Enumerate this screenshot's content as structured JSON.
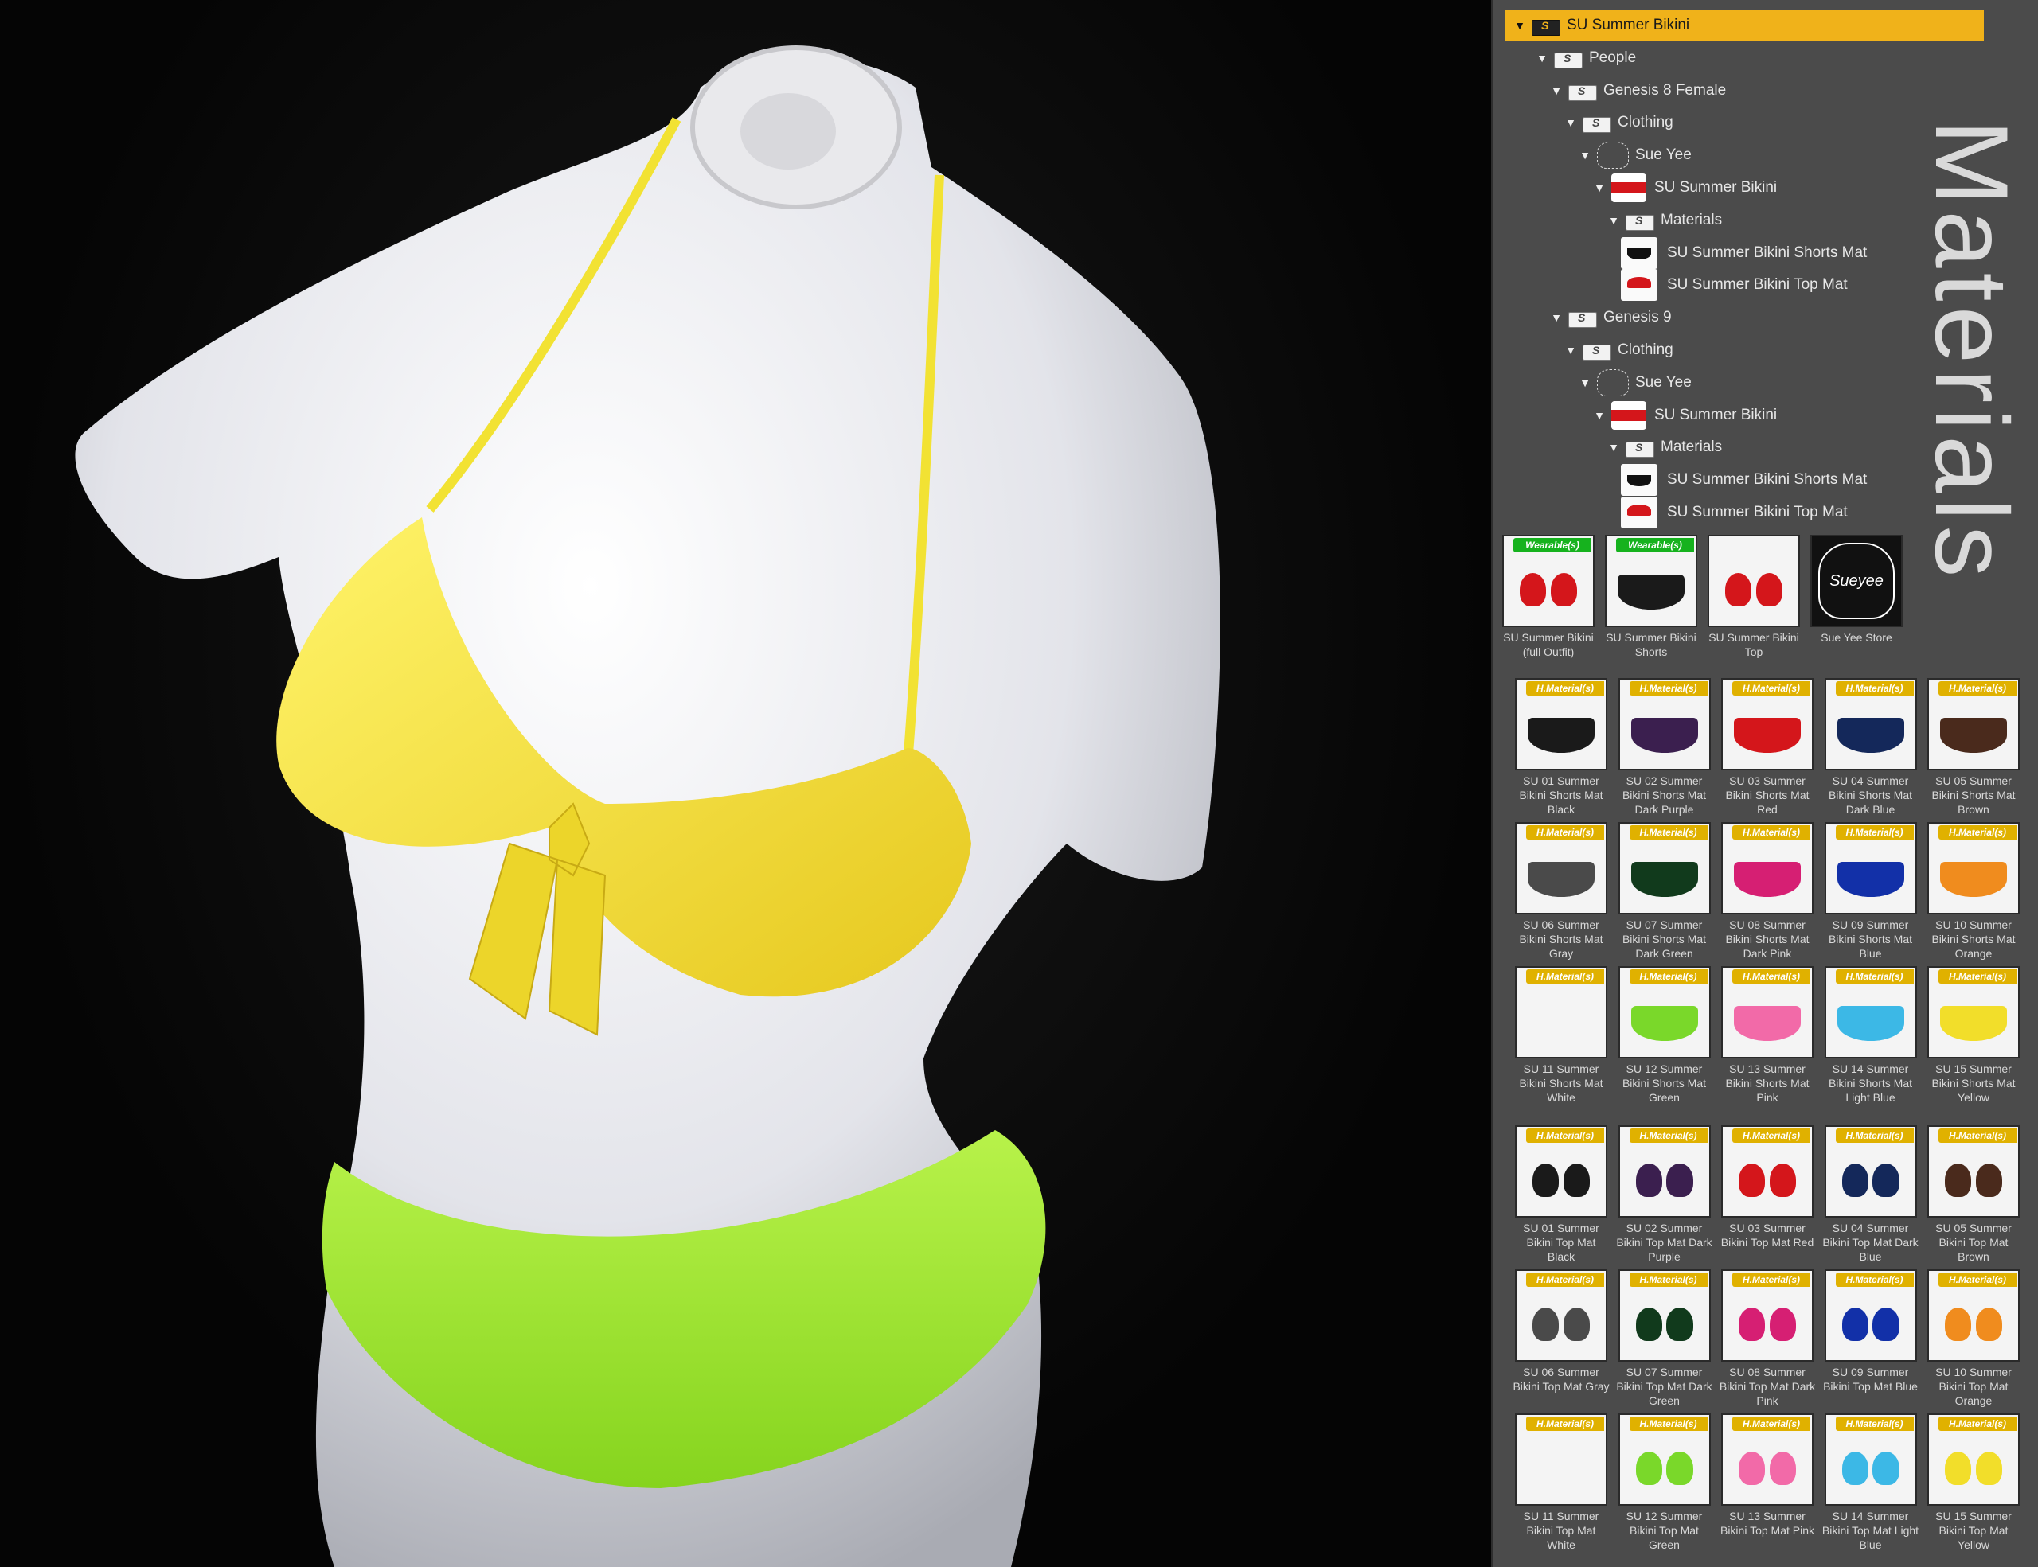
{
  "tree": [
    {
      "label": "SU Summer Bikini",
      "icon": "folder-icon",
      "selected": true
    },
    {
      "label": "People",
      "icon": "folder-icon"
    },
    {
      "label": "Genesis 8 Female",
      "icon": "folder-icon"
    },
    {
      "label": "Clothing",
      "icon": "folder-icon"
    },
    {
      "label": "Sue Yee",
      "icon": "vendor-icon"
    },
    {
      "label": "SU Summer Bikini",
      "icon": "product-icon"
    },
    {
      "label": "Materials",
      "icon": "folder-icon"
    },
    {
      "label": "SU Summer Bikini Shorts Mat",
      "icon": "material-icon"
    },
    {
      "label": "SU Summer Bikini Top Mat",
      "icon": "material-icon"
    },
    {
      "label": "Genesis 9",
      "icon": "folder-icon"
    },
    {
      "label": "Clothing",
      "icon": "folder-icon"
    },
    {
      "label": "Sue Yee",
      "icon": "vendor-icon"
    },
    {
      "label": "SU Summer Bikini",
      "icon": "product-icon"
    },
    {
      "label": "Materials",
      "icon": "folder-icon"
    },
    {
      "label": "SU Summer Bikini Shorts Mat",
      "icon": "material-icon"
    },
    {
      "label": "SU Summer Bikini Top Mat",
      "icon": "material-icon"
    }
  ],
  "side_title": "Materials",
  "top_tiles": [
    {
      "badge": "Wearable(s)",
      "caption": "SU Summer Bikini\n(full Outfit)"
    },
    {
      "badge": "Wearable(s)",
      "caption": "SU Summer Bikini\nShorts"
    },
    {
      "badge": "",
      "caption": "SU Summer Bikini\nTop"
    },
    {
      "badge": "",
      "caption": "Sue Yee Store",
      "logo": "Sueyee"
    }
  ],
  "mat_badge": "H.Material(s)",
  "shorts_tiles": [
    {
      "caption": "SU 01 Summer\nBikini Shorts Mat\nBlack",
      "color": "#1a1a1a"
    },
    {
      "caption": "SU 02 Summer\nBikini Shorts Mat\nDark Purple",
      "color": "#3b1f4f"
    },
    {
      "caption": "SU 03 Summer\nBikini Shorts Mat\nRed",
      "color": "#d4161b"
    },
    {
      "caption": "SU 04 Summer\nBikini Shorts Mat\nDark Blue",
      "color": "#14285a"
    },
    {
      "caption": "SU 05 Summer\nBikini Shorts Mat\nBrown",
      "color": "#4a2a1c"
    },
    {
      "caption": "SU 06 Summer\nBikini Shorts Mat\nGray",
      "color": "#4a4a4a"
    },
    {
      "caption": "SU 07 Summer\nBikini Shorts Mat\nDark Green",
      "color": "#113a1c"
    },
    {
      "caption": "SU 08 Summer\nBikini Shorts Mat\nDark Pink",
      "color": "#d61f73"
    },
    {
      "caption": "SU 09 Summer\nBikini Shorts Mat\nBlue",
      "color": "#1230a8"
    },
    {
      "caption": "SU 10 Summer\nBikini Shorts Mat\nOrange",
      "color": "#f08c1e"
    },
    {
      "caption": "SU 11 Summer\nBikini Shorts Mat\nWhite",
      "color": "#f4f4f4"
    },
    {
      "caption": "SU 12 Summer\nBikini Shorts Mat\nGreen",
      "color": "#7ad82a"
    },
    {
      "caption": "SU 13 Summer\nBikini Shorts Mat\nPink",
      "color": "#f26aa8"
    },
    {
      "caption": "SU 14 Summer\nBikini Shorts Mat\nLight Blue",
      "color": "#3cb8e6"
    },
    {
      "caption": "SU 15 Summer\nBikini Shorts Mat\nYellow",
      "color": "#f2de2a"
    }
  ],
  "top_mat_tiles": [
    {
      "caption": "SU 01 Summer\nBikini Top Mat\nBlack",
      "color": "#1a1a1a"
    },
    {
      "caption": "SU 02 Summer\nBikini Top Mat Dark\nPurple",
      "color": "#3b1f4f"
    },
    {
      "caption": "SU 03 Summer\nBikini Top Mat Red",
      "color": "#d4161b"
    },
    {
      "caption": "SU 04 Summer\nBikini Top Mat Dark\nBlue",
      "color": "#14285a"
    },
    {
      "caption": "SU 05 Summer\nBikini Top Mat\nBrown",
      "color": "#4a2a1c"
    },
    {
      "caption": "SU 06 Summer\nBikini Top Mat Gray",
      "color": "#4a4a4a"
    },
    {
      "caption": "SU 07 Summer\nBikini Top Mat Dark\nGreen",
      "color": "#113a1c"
    },
    {
      "caption": "SU 08 Summer\nBikini Top Mat Dark\nPink",
      "color": "#d61f73"
    },
    {
      "caption": "SU 09 Summer\nBikini Top Mat Blue",
      "color": "#1230a8"
    },
    {
      "caption": "SU 10 Summer\nBikini Top Mat\nOrange",
      "color": "#f08c1e"
    },
    {
      "caption": "SU 11 Summer\nBikini Top Mat\nWhite",
      "color": "#f4f4f4"
    },
    {
      "caption": "SU 12 Summer\nBikini Top Mat\nGreen",
      "color": "#7ad82a"
    },
    {
      "caption": "SU 13 Summer\nBikini Top Mat Pink",
      "color": "#f26aa8"
    },
    {
      "caption": "SU 14 Summer\nBikini Top Mat Light\nBlue",
      "color": "#3cb8e6"
    },
    {
      "caption": "SU 15 Summer\nBikini Top Mat\nYellow",
      "color": "#f2de2a"
    }
  ],
  "colors": {
    "selected_row": "#f0b21a",
    "panel_bg": "#4b4b4b",
    "top_color": "#f2e233",
    "shorts_color": "#a6ee3a",
    "mannequin": "#e9eaee"
  }
}
